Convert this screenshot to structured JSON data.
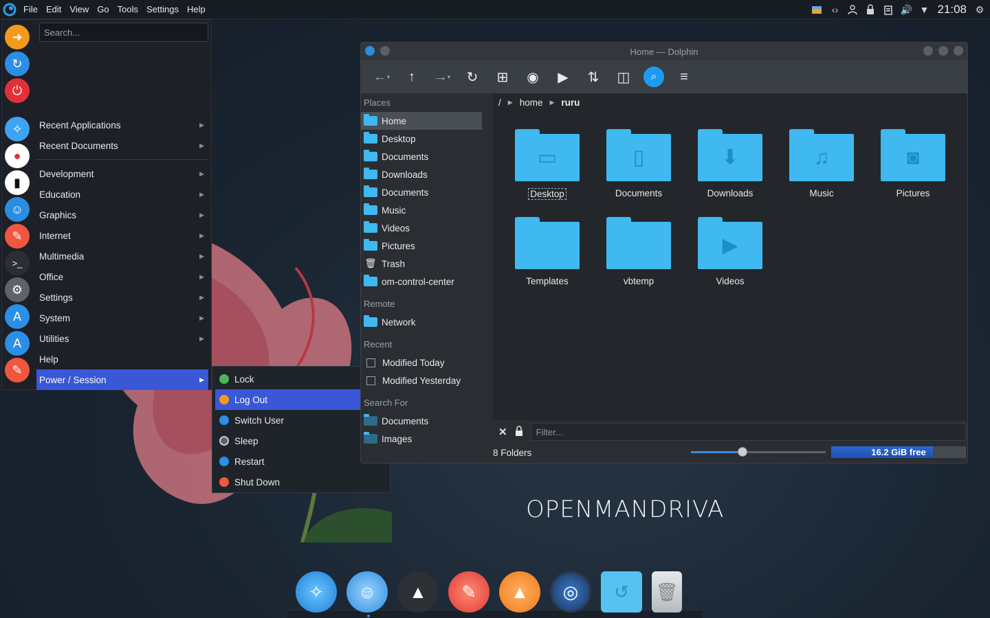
{
  "topbar": {
    "menu": [
      "File",
      "Edit",
      "View",
      "Go",
      "Tools",
      "Settings",
      "Help"
    ],
    "clock": "21:08",
    "tray_icons": [
      "package-icon",
      "network-icon",
      "user-icon",
      "lock-icon",
      "clipboard-icon",
      "volume-icon",
      "dropdown-icon",
      "gear-icon"
    ]
  },
  "appmenu": {
    "search_placeholder": "Search...",
    "launchers": [
      "arrow-icon",
      "refresh-icon",
      "power-icon",
      "safari-icon",
      "chat-icon",
      "phone-icon",
      "finder-icon",
      "pencil-icon",
      "terminal-icon",
      "settings-icon",
      "appstore-icon",
      "appstore-icon",
      "pencil-icon"
    ],
    "categories_top": [
      "Recent Applications",
      "Recent Documents"
    ],
    "categories": [
      "Development",
      "Education",
      "Graphics",
      "Internet",
      "Multimedia",
      "Office",
      "Settings",
      "System",
      "Utilities"
    ],
    "help": "Help",
    "power": "Power / Session",
    "submenu": [
      "Lock",
      "Log Out",
      "Switch User",
      "Sleep",
      "Restart",
      "Shut Down"
    ]
  },
  "dolphin": {
    "title": "Home — Dolphin",
    "places_header": "Places",
    "places": [
      "Home",
      "Desktop",
      "Documents",
      "Downloads",
      "Documents",
      "Music",
      "Videos",
      "Pictures",
      "Trash",
      "om-control-center"
    ],
    "remote_header": "Remote",
    "remote": [
      "Network"
    ],
    "recent_header": "Recent",
    "recent": [
      "Modified Today",
      "Modified Yesterday"
    ],
    "search_header": "Search For",
    "search": [
      "Documents",
      "Images"
    ],
    "breadcrumb": {
      "root": "/",
      "home": "home",
      "current": "ruru"
    },
    "folders": [
      "Desktop",
      "Documents",
      "Downloads",
      "Music",
      "Pictures",
      "Templates",
      "vbtemp",
      "Videos"
    ],
    "filter_placeholder": "Filter...",
    "status": "8 Folders",
    "free": "16.2 GiB free",
    "zoom_level": 0.4,
    "disk_used_fraction": 0.76
  },
  "brand": "OPENMANDRIVA",
  "dock": [
    "safari-icon",
    "finder-icon",
    "inkscape-icon",
    "pencil-icon",
    "vlc-icon",
    "disk-icon",
    "folder-history-icon",
    "trash-icon"
  ],
  "colors": {
    "accent": "#3a57d8",
    "folder": "#3fb9ef",
    "dark": "#1d2127"
  }
}
